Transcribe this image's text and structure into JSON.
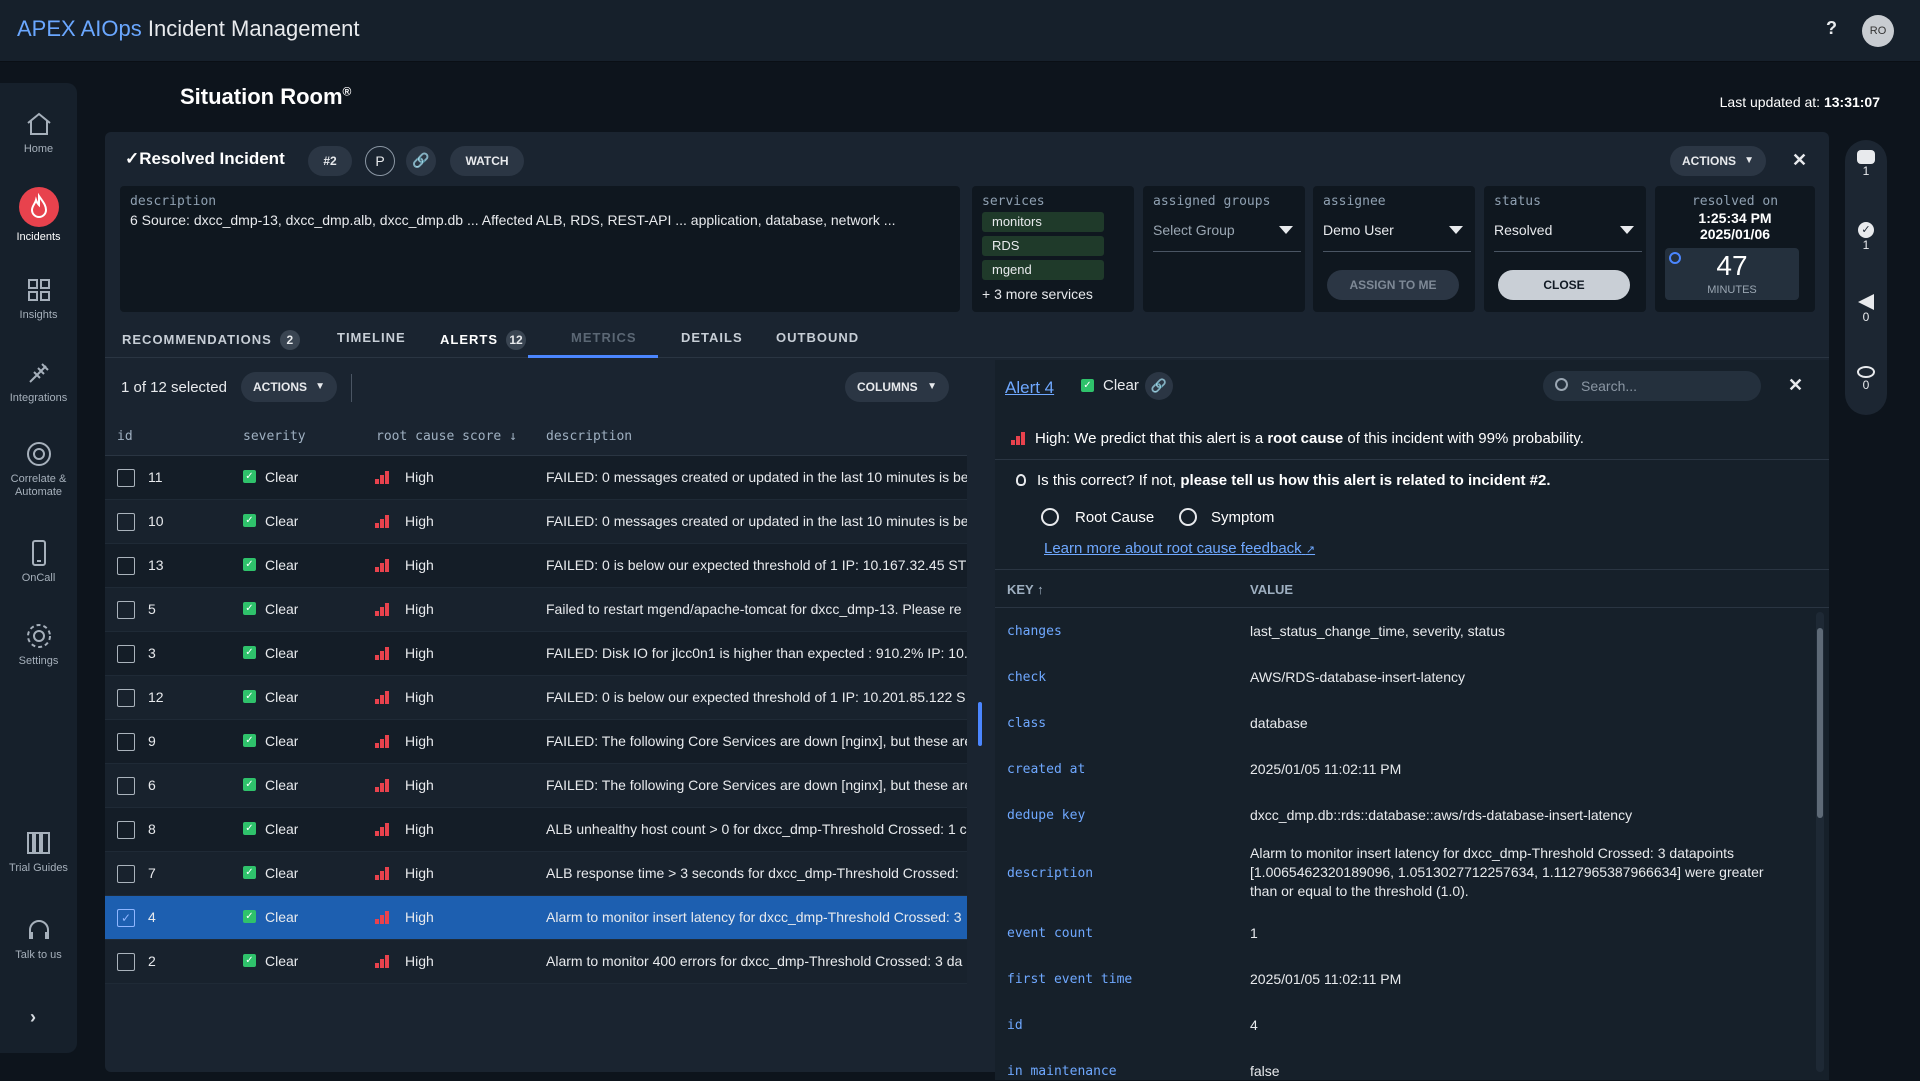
{
  "app": {
    "title_brand": "APEX AIOps",
    "title_rest": " Incident Management",
    "help": "?",
    "avatar": "RO"
  },
  "nav": [
    {
      "label": "Home",
      "icon": "home-icon"
    },
    {
      "label": "Incidents",
      "icon": "fire-icon",
      "active": true
    },
    {
      "label": "Insights",
      "icon": "grid-icon"
    },
    {
      "label": "Integrations",
      "icon": "plug-icon"
    },
    {
      "label": "Correlate & Automate",
      "icon": "target-icon"
    },
    {
      "label": "OnCall",
      "icon": "phone-icon"
    },
    {
      "label": "Settings",
      "icon": "gear-icon"
    },
    {
      "label": "Trial Guides",
      "icon": "books-icon"
    },
    {
      "label": "Talk to us",
      "icon": "headset-icon"
    }
  ],
  "page": {
    "title": "Situation Room",
    "title_mark": "®",
    "last_updated_label": "Last updated at: ",
    "last_updated_time": "13:31:07"
  },
  "incident": {
    "heading": "Resolved Incident",
    "number": "#2",
    "priority": "P",
    "watch": "WATCH",
    "actions": "ACTIONS",
    "description_label": "description",
    "description": "6 Source: dxcc_dmp-13, dxcc_dmp.alb, dxcc_dmp.db ... Affected ALB, RDS, REST-API ... application, database, network ...",
    "services_label": "services",
    "services": [
      "monitors",
      "RDS",
      "mgend"
    ],
    "more_services": "+ 3 more services",
    "groups_label": "assigned groups",
    "groups_placeholder": "Select Group",
    "assignee_label": "assignee",
    "assignee": "Demo User",
    "assign_to_me": "ASSIGN TO ME",
    "status_label": "status",
    "status": "Resolved",
    "close": "CLOSE",
    "resolved_label": "resolved on",
    "resolved_time": "1:25:34 PM",
    "resolved_date": "2025/01/06",
    "duration_value": "47",
    "duration_unit": "MINUTES"
  },
  "tabs": [
    {
      "label": "RECOMMENDATIONS",
      "count": "2"
    },
    {
      "label": "TIMELINE"
    },
    {
      "label": "ALERTS",
      "count": "12",
      "active": true
    },
    {
      "label": "METRICS",
      "disabled": true
    },
    {
      "label": "DETAILS"
    },
    {
      "label": "OUTBOUND"
    }
  ],
  "alerts": {
    "selected_text": "1 of 12 selected",
    "actions": "ACTIONS",
    "columns": "COLUMNS",
    "headers": {
      "id": "id",
      "severity": "severity",
      "score": "root cause score",
      "description": "description"
    },
    "rows": [
      {
        "id": "11",
        "severity": "Clear",
        "score": "High",
        "description": "FAILED: 0 messages created or updated in the last 10 minutes is be"
      },
      {
        "id": "10",
        "severity": "Clear",
        "score": "High",
        "description": "FAILED: 0 messages created or updated in the last 10 minutes is be"
      },
      {
        "id": "13",
        "severity": "Clear",
        "score": "High",
        "description": "FAILED: 0 is below our expected threshold of 1 IP: 10.167.32.45 ST"
      },
      {
        "id": "5",
        "severity": "Clear",
        "score": "High",
        "description": "Failed to restart mgend/apache-tomcat for dxcc_dmp-13. Please re"
      },
      {
        "id": "3",
        "severity": "Clear",
        "score": "High",
        "description": "FAILED: Disk IO for jlcc0n1 is higher than expected : 910.2% IP: 10."
      },
      {
        "id": "12",
        "severity": "Clear",
        "score": "High",
        "description": "FAILED: 0 is below our expected threshold of 1 IP: 10.201.85.122 S"
      },
      {
        "id": "9",
        "severity": "Clear",
        "score": "High",
        "description": "FAILED: The following Core Services are down [nginx], but these are"
      },
      {
        "id": "6",
        "severity": "Clear",
        "score": "High",
        "description": "FAILED: The following Core Services are down [nginx], but these are"
      },
      {
        "id": "8",
        "severity": "Clear",
        "score": "High",
        "description": "ALB unhealthy host count > 0 for dxcc_dmp-Threshold Crossed: 1 c"
      },
      {
        "id": "7",
        "severity": "Clear",
        "score": "High",
        "description": "ALB response time > 3 seconds for dxcc_dmp-Threshold Crossed:"
      },
      {
        "id": "4",
        "severity": "Clear",
        "score": "High",
        "description": "Alarm to monitor insert latency for dxcc_dmp-Threshold Crossed: 3",
        "selected": true
      },
      {
        "id": "2",
        "severity": "Clear",
        "score": "High",
        "description": "Alarm to monitor 400 errors for dxcc_dmp-Threshold Crossed: 3 da"
      }
    ]
  },
  "detail": {
    "title": "Alert 4",
    "status": "Clear",
    "search_placeholder": "Search...",
    "prediction_pre": "High: We predict that this alert is a ",
    "prediction_bold": "root cause",
    "prediction_post": " of this incident with 99% probability.",
    "question_pre": "Is this correct? If not, ",
    "question_bold": "please tell us how this alert is related to incident #2.",
    "opt_root": "Root Cause",
    "opt_symptom": "Symptom",
    "learn_more": "Learn more about root cause feedback",
    "key_header": "KEY",
    "value_header": "VALUE",
    "fields": [
      {
        "key": "changes",
        "value": "last_status_change_time, severity, status"
      },
      {
        "key": "check",
        "value": "AWS/RDS-database-insert-latency"
      },
      {
        "key": "class",
        "value": "database"
      },
      {
        "key": "created at",
        "value": "2025/01/05 11:02:11 PM"
      },
      {
        "key": "dedupe key",
        "value": "dxcc_dmp.db::rds::database::aws/rds-database-insert-latency"
      },
      {
        "key": "description",
        "value": "Alarm to monitor insert latency for dxcc_dmp-Threshold Crossed: 3 datapoints [1.0065462320189096, 1.0513027712257634, 1.1127965387966634] were greater than or equal to the threshold (1.0)."
      },
      {
        "key": "event count",
        "value": "1"
      },
      {
        "key": "first event time",
        "value": "2025/01/05 11:02:11 PM"
      },
      {
        "key": "id",
        "value": "4"
      },
      {
        "key": "in maintenance",
        "value": "false"
      }
    ]
  },
  "right_rail": [
    {
      "icon": "chat-icon",
      "count": "1"
    },
    {
      "icon": "check-badge-icon",
      "count": "1"
    },
    {
      "icon": "megaphone-icon",
      "count": "0"
    },
    {
      "icon": "eye-icon",
      "count": "0"
    }
  ],
  "colors": {
    "accent": "#4b86ff",
    "danger": "#e8424d",
    "clear": "#2fc26b"
  }
}
